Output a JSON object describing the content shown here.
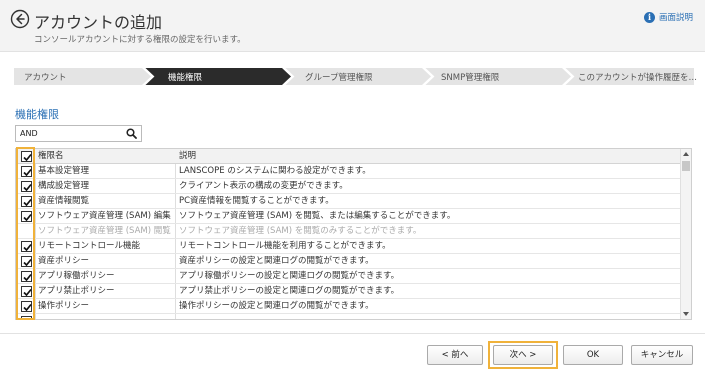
{
  "header": {
    "title": "アカウントの追加",
    "subtitle": "コンソールアカウントに対する権限の設定を行います。",
    "help_label": "画面説明",
    "help_icon": "info-icon",
    "back_icon": "back-arrow-icon"
  },
  "steps": [
    {
      "label": "アカウント",
      "active": false
    },
    {
      "label": "機能権限",
      "active": true
    },
    {
      "label": "グループ管理権限",
      "active": false
    },
    {
      "label": "SNMP管理権限",
      "active": false
    },
    {
      "label": "このアカウントが操作履歴を…",
      "active": false
    }
  ],
  "section_title": "機能権限",
  "search": {
    "value": "AND",
    "icon": "search-icon"
  },
  "table": {
    "headers": {
      "name": "権限名",
      "desc": "説明"
    },
    "rows": [
      {
        "name": "基本設定管理",
        "desc": "LANSCOPE のシステムに関わる設定ができます。",
        "checked": true,
        "disabled": false
      },
      {
        "name": "構成設定管理",
        "desc": "クライアント表示の構成の変更ができます。",
        "checked": true,
        "disabled": false
      },
      {
        "name": "資産情報閲覧",
        "desc": "PC資産情報を閲覧することができます。",
        "checked": true,
        "disabled": false
      },
      {
        "name": "ソフトウェア資産管理 (SAM) 編集",
        "desc": "ソフトウェア資産管理 (SAM) を閲覧、または編集することができます。",
        "checked": true,
        "disabled": false
      },
      {
        "name": "ソフトウェア資産管理 (SAM) 閲覧",
        "desc": "ソフトウェア資産管理 (SAM) を閲覧のみすることができます。",
        "checked": false,
        "disabled": true
      },
      {
        "name": "リモートコントロール機能",
        "desc": "リモートコントロール機能を利用することができます。",
        "checked": true,
        "disabled": false
      },
      {
        "name": "資産ポリシー",
        "desc": "資産ポリシーの設定と関連ログの閲覧ができます。",
        "checked": true,
        "disabled": false
      },
      {
        "name": "アプリ稼働ポリシー",
        "desc": "アプリ稼働ポリシーの設定と関連ログの閲覧ができます。",
        "checked": true,
        "disabled": false
      },
      {
        "name": "アプリ禁止ポリシー",
        "desc": "アプリ禁止ポリシーの設定と関連ログの閲覧ができます。",
        "checked": true,
        "disabled": false
      },
      {
        "name": "操作ポリシー",
        "desc": "操作ポリシーの設定と関連ログの閲覧ができます。",
        "checked": true,
        "disabled": false
      }
    ]
  },
  "buttons": {
    "prev": "< 前へ",
    "next": "次へ >",
    "ok": "OK",
    "cancel": "キャンセル"
  },
  "colors": {
    "accent": "#2a6fb4",
    "highlight": "#f0b23a",
    "active_step": "#2b2b2b",
    "inactive_step": "#e4e4e4"
  }
}
